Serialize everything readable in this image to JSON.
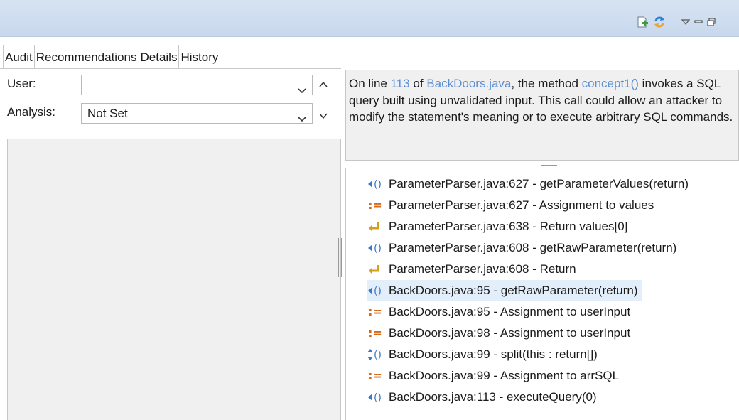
{
  "toolbar": {
    "icons": [
      "new-document-icon",
      "refresh-icon",
      "view-menu-icon",
      "minimize-icon",
      "maximize-icon"
    ]
  },
  "tabs": [
    {
      "label": "Audit"
    },
    {
      "label": "Recommendations"
    },
    {
      "label": "Details"
    },
    {
      "label": "History"
    }
  ],
  "audit": {
    "user_label": "User:",
    "user_value": "",
    "analysis_label": "Analysis:",
    "analysis_value": "Not Set"
  },
  "description": {
    "prefix": "On line ",
    "line_number": "113",
    "of_text": " of ",
    "file": "BackDoors.java",
    "method_text": ", the method ",
    "method": "concept1()",
    "body": " invokes a SQL query built using unvalidated input.  This call could allow an attacker to modify the statement's meaning or to execute arbitrary SQL commands."
  },
  "trace": [
    {
      "icon": "call-return-icon",
      "text": "ParameterParser.java:627 - getParameterValues(return)"
    },
    {
      "icon": "assignment-icon",
      "text": "ParameterParser.java:627 - Assignment to values"
    },
    {
      "icon": "return-arrow-icon",
      "text": "ParameterParser.java:638 - Return values[0]"
    },
    {
      "icon": "call-return-icon",
      "text": "ParameterParser.java:608 - getRawParameter(return)"
    },
    {
      "icon": "return-arrow-icon",
      "text": "ParameterParser.java:608 - Return"
    },
    {
      "icon": "call-return-icon",
      "text": "BackDoors.java:95 - getRawParameter(return)",
      "selected": true
    },
    {
      "icon": "assignment-icon",
      "text": "BackDoors.java:95 - Assignment to userInput"
    },
    {
      "icon": "assignment-icon",
      "text": "BackDoors.java:98 - Assignment to userInput"
    },
    {
      "icon": "call-pass-icon",
      "text": "BackDoors.java:99 - split(this : return[])"
    },
    {
      "icon": "assignment-icon",
      "text": "BackDoors.java:99 - Assignment to arrSQL"
    },
    {
      "icon": "call-return-icon",
      "text": "BackDoors.java:113 - executeQuery(0)"
    }
  ],
  "colors": {
    "link": "#5c8fd1",
    "call_icon": "#3a78c9",
    "assign_icon": "#d46a1a",
    "return_icon": "#d4a017",
    "selection": "#e3eefb"
  }
}
